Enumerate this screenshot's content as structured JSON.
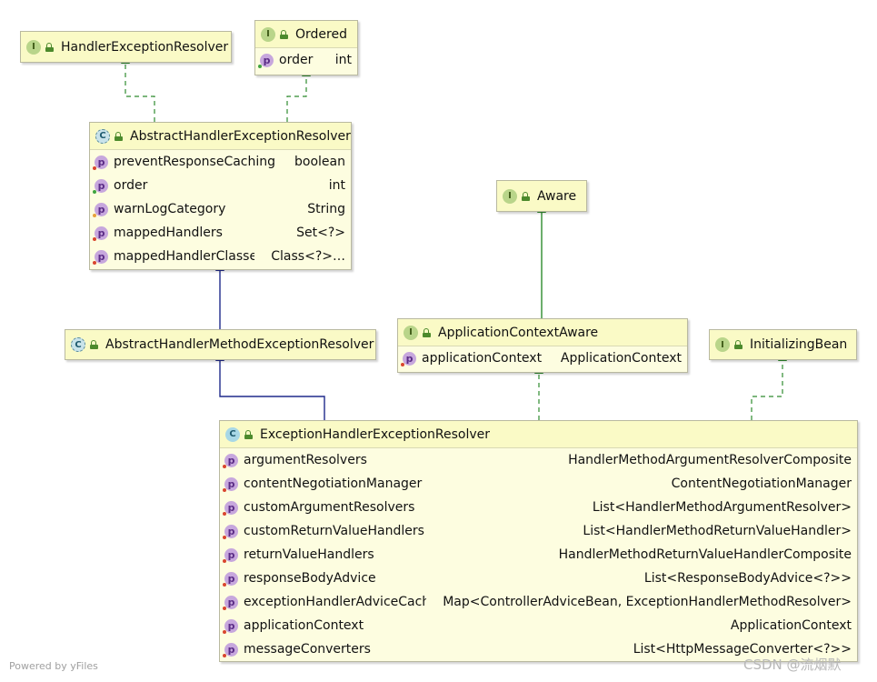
{
  "nodes": [
    {
      "id": "handler-exception-resolver",
      "kind": "I",
      "kind_type": "interface",
      "title": "HandlerExceptionResolver",
      "fields": []
    },
    {
      "id": "ordered",
      "kind": "I",
      "kind_type": "interface",
      "title": "Ordered",
      "fields": [
        {
          "name": "order",
          "type": "int",
          "visibility": "public"
        }
      ]
    },
    {
      "id": "abstract-handler-exception-resolver",
      "kind": "C",
      "kind_type": "abstract",
      "title": "AbstractHandlerExceptionResolver",
      "fields": [
        {
          "name": "preventResponseCaching",
          "type": "boolean",
          "visibility": "private"
        },
        {
          "name": "order",
          "type": "int",
          "visibility": "public"
        },
        {
          "name": "warnLogCategory",
          "type": "String",
          "visibility": "protected"
        },
        {
          "name": "mappedHandlers",
          "type": "Set<?>",
          "visibility": "private"
        },
        {
          "name": "mappedHandlerClasses",
          "type": "Class<?>…",
          "visibility": "private"
        }
      ]
    },
    {
      "id": "aware",
      "kind": "I",
      "kind_type": "interface",
      "title": "Aware",
      "fields": []
    },
    {
      "id": "abstract-handler-method-exception-resolver",
      "kind": "C",
      "kind_type": "abstract",
      "title": "AbstractHandlerMethodExceptionResolver",
      "fields": []
    },
    {
      "id": "application-context-aware",
      "kind": "I",
      "kind_type": "interface",
      "title": "ApplicationContextAware",
      "fields": [
        {
          "name": "applicationContext",
          "type": "ApplicationContext",
          "visibility": "private"
        }
      ]
    },
    {
      "id": "initializing-bean",
      "kind": "I",
      "kind_type": "interface",
      "title": "InitializingBean",
      "fields": []
    },
    {
      "id": "exception-handler-exception-resolver",
      "kind": "C",
      "kind_type": "class",
      "title": "ExceptionHandlerExceptionResolver",
      "fields": [
        {
          "name": "argumentResolvers",
          "type": "HandlerMethodArgumentResolverComposite",
          "visibility": "private"
        },
        {
          "name": "contentNegotiationManager",
          "type": "ContentNegotiationManager",
          "visibility": "private"
        },
        {
          "name": "customArgumentResolvers",
          "type": "List<HandlerMethodArgumentResolver>",
          "visibility": "private"
        },
        {
          "name": "customReturnValueHandlers",
          "type": "List<HandlerMethodReturnValueHandler>",
          "visibility": "private"
        },
        {
          "name": "returnValueHandlers",
          "type": "HandlerMethodReturnValueHandlerComposite",
          "visibility": "private"
        },
        {
          "name": "responseBodyAdvice",
          "type": "List<ResponseBodyAdvice<?>>",
          "visibility": "private"
        },
        {
          "name": "exceptionHandlerAdviceCache",
          "type": "Map<ControllerAdviceBean, ExceptionHandlerMethodResolver>",
          "visibility": "private"
        },
        {
          "name": "applicationContext",
          "type": "ApplicationContext",
          "visibility": "private"
        },
        {
          "name": "messageConverters",
          "type": "List<HttpMessageConverter<?>>",
          "visibility": "private"
        }
      ]
    }
  ],
  "edges": [
    {
      "from": "abstract-handler-exception-resolver",
      "to": "handler-exception-resolver",
      "relation": "implements"
    },
    {
      "from": "abstract-handler-exception-resolver",
      "to": "ordered",
      "relation": "implements"
    },
    {
      "from": "abstract-handler-method-exception-resolver",
      "to": "abstract-handler-exception-resolver",
      "relation": "extends"
    },
    {
      "from": "exception-handler-exception-resolver",
      "to": "abstract-handler-method-exception-resolver",
      "relation": "extends"
    },
    {
      "from": "application-context-aware",
      "to": "aware",
      "relation": "extends-interface"
    },
    {
      "from": "exception-handler-exception-resolver",
      "to": "application-context-aware",
      "relation": "implements"
    },
    {
      "from": "exception-handler-exception-resolver",
      "to": "initializing-bean",
      "relation": "implements"
    }
  ],
  "colors": {
    "implements": "#2e8b2e",
    "extends": "#1f2a8c",
    "extends-interface": "#2e8b2e"
  },
  "watermarks": {
    "left": "Powered by yFiles",
    "right": "CSDN @流烟默"
  }
}
